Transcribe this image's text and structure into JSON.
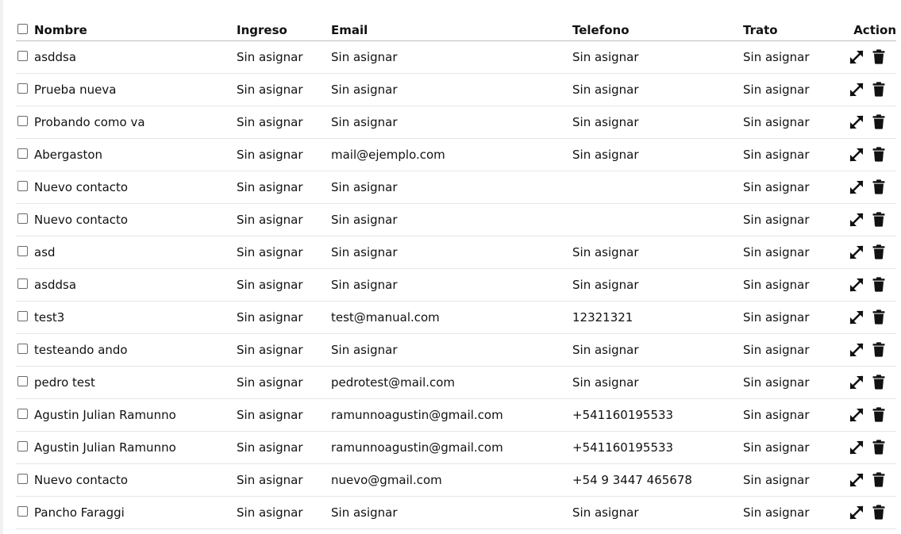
{
  "table": {
    "headers": {
      "nombre": "Nombre",
      "ingreso": "Ingreso",
      "email": "Email",
      "telefono": "Telefono",
      "trato": "Trato",
      "action": "Action"
    },
    "rows": [
      {
        "nombre": "asddsa",
        "ingreso": "Sin asignar",
        "email": "Sin asignar",
        "telefono": "Sin asignar",
        "trato": "Sin asignar"
      },
      {
        "nombre": "Prueba nueva",
        "ingreso": "Sin asignar",
        "email": "Sin asignar",
        "telefono": "Sin asignar",
        "trato": "Sin asignar"
      },
      {
        "nombre": "Probando como va",
        "ingreso": "Sin asignar",
        "email": "Sin asignar",
        "telefono": "Sin asignar",
        "trato": "Sin asignar"
      },
      {
        "nombre": "Abergaston",
        "ingreso": "Sin asignar",
        "email": "mail@ejemplo.com",
        "telefono": "Sin asignar",
        "trato": "Sin asignar"
      },
      {
        "nombre": "Nuevo contacto",
        "ingreso": "Sin asignar",
        "email": "Sin asignar",
        "telefono": "",
        "trato": "Sin asignar"
      },
      {
        "nombre": "Nuevo contacto",
        "ingreso": "Sin asignar",
        "email": "Sin asignar",
        "telefono": "",
        "trato": "Sin asignar"
      },
      {
        "nombre": "asd",
        "ingreso": "Sin asignar",
        "email": "Sin asignar",
        "telefono": "Sin asignar",
        "trato": "Sin asignar"
      },
      {
        "nombre": "asddsa",
        "ingreso": "Sin asignar",
        "email": "Sin asignar",
        "telefono": "Sin asignar",
        "trato": "Sin asignar"
      },
      {
        "nombre": "test3",
        "ingreso": "Sin asignar",
        "email": "test@manual.com",
        "telefono": "12321321",
        "trato": "Sin asignar"
      },
      {
        "nombre": "testeando ando",
        "ingreso": "Sin asignar",
        "email": "Sin asignar",
        "telefono": "Sin asignar",
        "trato": "Sin asignar"
      },
      {
        "nombre": "pedro test",
        "ingreso": "Sin asignar",
        "email": "pedrotest@mail.com",
        "telefono": "Sin asignar",
        "trato": "Sin asignar"
      },
      {
        "nombre": "Agustin Julian Ramunno",
        "ingreso": "Sin asignar",
        "email": "ramunnoagustin@gmail.com",
        "telefono": "+541160195533",
        "trato": "Sin asignar"
      },
      {
        "nombre": "Agustin Julian Ramunno",
        "ingreso": "Sin asignar",
        "email": "ramunnoagustin@gmail.com",
        "telefono": "+541160195533",
        "trato": "Sin asignar"
      },
      {
        "nombre": "Nuevo contacto",
        "ingreso": "Sin asignar",
        "email": "nuevo@gmail.com",
        "telefono": "+54 9 3447 465678",
        "trato": "Sin asignar"
      },
      {
        "nombre": "Pancho Faraggi",
        "ingreso": "Sin asignar",
        "email": "Sin asignar",
        "telefono": "Sin asignar",
        "trato": "Sin asignar"
      }
    ]
  },
  "icons": {
    "expand": "expand-icon",
    "delete": "trash-icon",
    "checkbox": "checkbox"
  },
  "colors": {
    "text": "#111111",
    "header_border": "#bdbdbd",
    "row_border": "#e6e6e6"
  }
}
